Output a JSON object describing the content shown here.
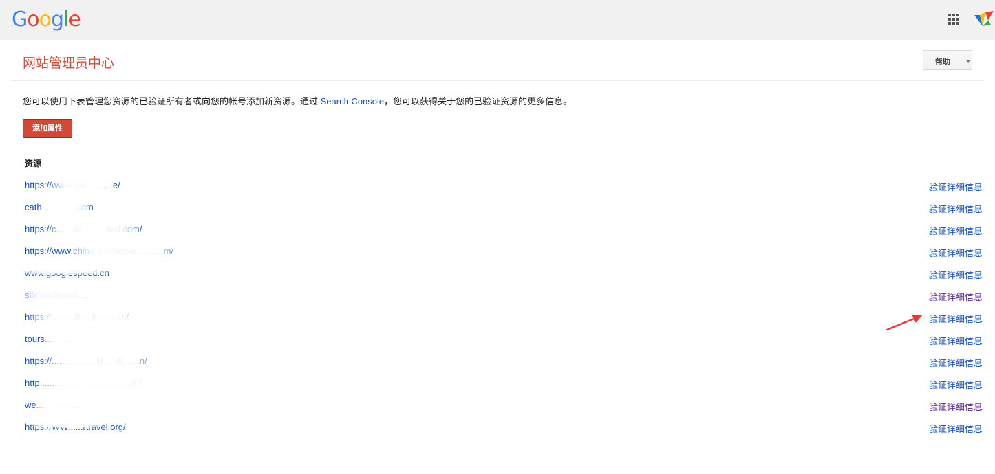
{
  "topbar": {
    "logo_letters": [
      {
        "ch": "G",
        "color": "#4285F4"
      },
      {
        "ch": "o",
        "color": "#EA4335"
      },
      {
        "ch": "o",
        "color": "#FBBC05"
      },
      {
        "ch": "g",
        "color": "#4285F4"
      },
      {
        "ch": "l",
        "color": "#34A853"
      },
      {
        "ch": "e",
        "color": "#EA4335"
      }
    ],
    "apps_icon": "apps-grid-icon",
    "avatar_icon": "avatar-icon"
  },
  "header": {
    "title": "网站管理员中心",
    "help_label": "帮助"
  },
  "intro": {
    "before": "您可以使用下表管理您资源的已验证所有者或向您的帐号添加新资源。通过 ",
    "link": "Search Console",
    "after": "，您可以获得关于您的已验证资源的更多信息。"
  },
  "add_property_label": "添加属性",
  "table": {
    "column_header": "资源",
    "rows": [
      {
        "site": "https://www.ww...........e/",
        "detail": "验证详细信息",
        "visited": false
      },
      {
        "site": "cath..............com",
        "detail": "验证详细信息",
        "visited": false
      },
      {
        "site": "https://c.......illl.........avel.com/",
        "detail": "验证详细信息",
        "visited": false
      },
      {
        "site": "https://www.china-silkroad-tr...........m/",
        "detail": "验证详细信息",
        "visited": false
      },
      {
        "site": "www.googlespeed.cn",
        "detail": "验证详细信息",
        "visited": false
      },
      {
        "site": "silkroadtravel....",
        "detail": "验证详细信息",
        "visited": true
      },
      {
        "site": "https://.........illl....lt.........m/",
        "detail": "验证详细信息",
        "visited": false
      },
      {
        "site": "tours.............",
        "detail": "验证详细信息",
        "visited": false
      },
      {
        "site": "https://..................kl.....dl.......n/",
        "detail": "验证详细信息",
        "visited": false
      },
      {
        "site": "http.....................................m/",
        "detail": "验证详细信息",
        "visited": false
      },
      {
        "site": "we...................",
        "detail": "验证详细信息",
        "visited": true
      },
      {
        "site": "https://WW......rtravel.org/",
        "detail": "验证详细信息",
        "visited": false
      }
    ]
  },
  "colors": {
    "accent_red": "#dd4b39",
    "button_red": "#d14836",
    "link_blue": "#1155cc",
    "link_visited": "#61279b",
    "annotation_arrow": "#e53935"
  }
}
